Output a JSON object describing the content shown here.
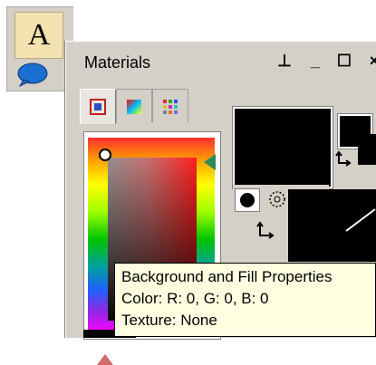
{
  "tools": {
    "text_tool_label": "A"
  },
  "window": {
    "title": "Materials",
    "buttons": {
      "pin": "⊥",
      "minimize": "_",
      "maximize": "☐",
      "close": "×"
    }
  },
  "tabs": [
    {
      "icon": "color-frame-icon",
      "active": true
    },
    {
      "icon": "gradient-tab-icon",
      "active": false
    },
    {
      "icon": "swatches-tab-icon",
      "active": false
    }
  ],
  "tooltip": {
    "line1": "Background and Fill Properties",
    "line2": "Color: R: 0, G: 0, B: 0",
    "line3": "Texture: None"
  },
  "colors": {
    "palette_bg": "#d4d0c8",
    "tooltip_bg": "#ffffe1",
    "fill_color": "#000000",
    "text_tool_bg": "#f3e2b0"
  }
}
